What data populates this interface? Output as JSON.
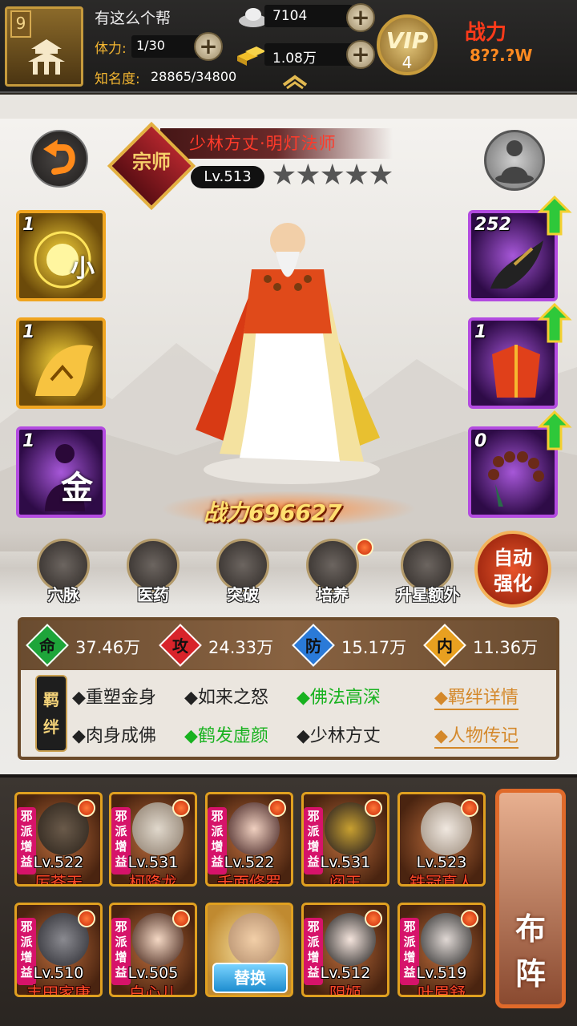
{
  "player": {
    "level": "9",
    "guild": "有这么个帮",
    "stamina_label": "体力:",
    "stamina": "1/30",
    "fame_label": "知名度:",
    "fame": "28865/34800",
    "silver": "7104",
    "gold": "1.08万",
    "vip_text": "VIP",
    "vip_level": "4",
    "power_label": "战力",
    "power_value": "8??.?W"
  },
  "hero": {
    "grade": "宗师",
    "title": "少林方丈·明灯法师",
    "level": "Lv.513",
    "stars": 5,
    "combat_power": "战力696627"
  },
  "left_slots": [
    {
      "count": "1",
      "glyph": "小",
      "icon": "sun-orb-icon"
    },
    {
      "count": "1",
      "glyph": "",
      "icon": "tiger-icon"
    },
    {
      "count": "1",
      "glyph": "金",
      "icon": "silhouette-icon"
    }
  ],
  "right_slots": [
    {
      "count": "252",
      "icon": "claw-weapon-icon"
    },
    {
      "count": "1",
      "icon": "robe-armor-icon"
    },
    {
      "count": "0",
      "icon": "prayer-beads-icon"
    }
  ],
  "menu": [
    {
      "label": "穴脉",
      "icon": "meridian-icon",
      "dot": false
    },
    {
      "label": "医药",
      "icon": "medicine-icon",
      "dot": false
    },
    {
      "label": "突破",
      "icon": "breakthrough-icon",
      "dot": false
    },
    {
      "label": "培养",
      "icon": "scroll-icon",
      "dot": true
    },
    {
      "label": "升星额外",
      "icon": "star-upgrade-icon",
      "dot": false
    }
  ],
  "auto_button": {
    "line1": "自动",
    "line2": "强化"
  },
  "stats": [
    {
      "key": "命",
      "value": "37.46万",
      "color": "#1ea53a"
    },
    {
      "key": "攻",
      "value": "24.33万",
      "color": "#d8242a"
    },
    {
      "key": "防",
      "value": "15.17万",
      "color": "#2a7ad8"
    },
    {
      "key": "内",
      "value": "11.36万",
      "color": "#e8a020"
    }
  ],
  "bond_label": {
    "a": "羁",
    "b": "绊"
  },
  "bonds_row1": [
    {
      "text": "◆重塑金身",
      "active": false
    },
    {
      "text": "◆如来之怒",
      "active": false
    },
    {
      "text": "◆佛法高深",
      "active": true
    }
  ],
  "bonds_row2": [
    {
      "text": "◆肉身成佛",
      "active": false
    },
    {
      "text": "◆鹤发虚颜",
      "active": true
    },
    {
      "text": "◆少林方丈",
      "active": false
    }
  ],
  "links": {
    "bond_detail": "◆羁绊详情",
    "biography": "◆人物传记"
  },
  "roster_tag": "邪派增益",
  "roster": [
    {
      "level": "Lv.522",
      "name": "厉苍天",
      "tag": true
    },
    {
      "level": "Lv.531",
      "name": "柯降龙",
      "tag": true
    },
    {
      "level": "Lv.522",
      "name": "千面修罗",
      "tag": true
    },
    {
      "level": "Lv.531",
      "name": "阎王",
      "tag": true
    },
    {
      "level": "Lv.523",
      "name": "铁冠真人",
      "tag": false
    },
    {
      "level": "Lv.510",
      "name": "丰田家康",
      "tag": true
    },
    {
      "level": "Lv.505",
      "name": "白心儿",
      "tag": true
    },
    {
      "level": "",
      "name": "",
      "tag": false,
      "swap": "替换"
    },
    {
      "level": "Lv.512",
      "name": "阴姬",
      "tag": true
    },
    {
      "level": "Lv.519",
      "name": "叶眉舒",
      "tag": true
    }
  ],
  "formation": {
    "a": "布",
    "b": "阵"
  }
}
